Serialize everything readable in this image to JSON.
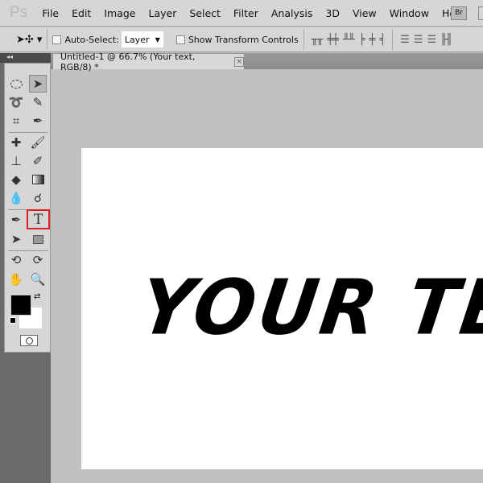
{
  "app": {
    "logo": "Ps",
    "bridge": "Br"
  },
  "menu": [
    "File",
    "Edit",
    "Image",
    "Layer",
    "Select",
    "Filter",
    "Analysis",
    "3D",
    "View",
    "Window",
    "Help"
  ],
  "options": {
    "auto_select_label": "Auto-Select:",
    "auto_select_checked": false,
    "auto_select_value": "Layer",
    "show_transform_label": "Show Transform Controls",
    "show_transform_checked": false
  },
  "panel_collapse": "◂◂",
  "document": {
    "tab_title": "Untitled-1 @ 66.7% (Your text, RGB/8) *",
    "close": "×",
    "text": "YOUR TEXT"
  },
  "tools": {
    "active": "type-tool",
    "highlight_color": "#e02020",
    "foreground": "#000000",
    "background": "#ffffff",
    "type_glyph": "T"
  }
}
